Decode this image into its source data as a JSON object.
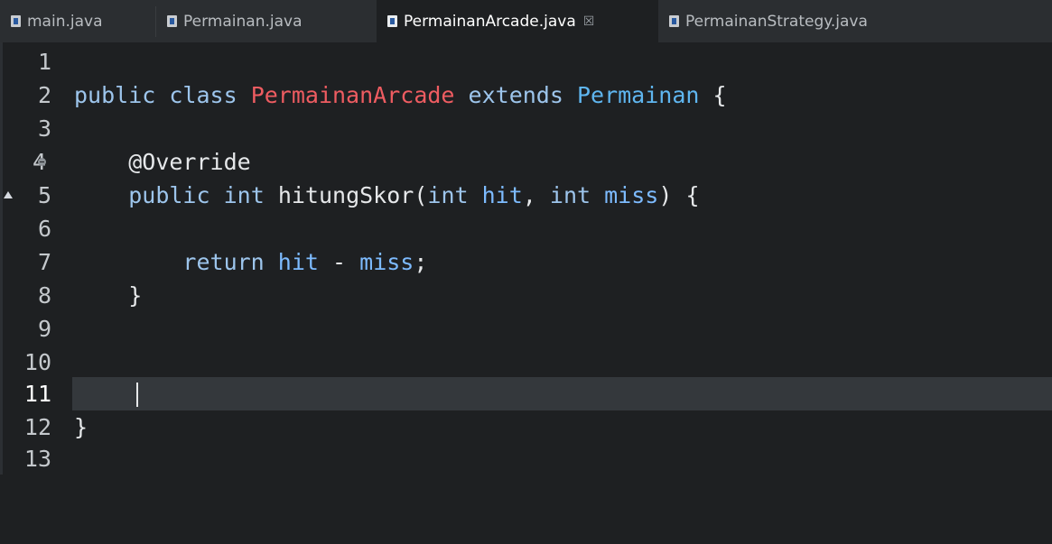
{
  "tabs": [
    {
      "label": "main.java",
      "active": false,
      "icon": "java-file-icon"
    },
    {
      "label": "Permainan.java",
      "active": false,
      "icon": "java-file-icon"
    },
    {
      "label": "PermainanArcade.java",
      "active": true,
      "icon": "java-file-icon",
      "close": "☒"
    },
    {
      "label": "PermainanStrategy.java",
      "active": false,
      "icon": "java-file-icon"
    }
  ],
  "editor": {
    "current_line": 11,
    "lines": [
      {
        "number": "1"
      },
      {
        "number": "2",
        "tokens": [
          "public",
          "class",
          "PermainanArcade",
          "extends",
          "Permainan",
          "{"
        ]
      },
      {
        "number": "3"
      },
      {
        "number": "4",
        "tokens": [
          "@Override"
        ]
      },
      {
        "number": "5",
        "tokens": [
          "public",
          "int",
          "hitungSkor(",
          "int",
          "hit",
          ",",
          "int",
          "miss",
          ")",
          "{"
        ]
      },
      {
        "number": "6"
      },
      {
        "number": "7",
        "tokens": [
          "return",
          "hit",
          "-",
          "miss",
          ";"
        ]
      },
      {
        "number": "8",
        "tokens": [
          "}"
        ]
      },
      {
        "number": "9"
      },
      {
        "number": "10"
      },
      {
        "number": "11"
      },
      {
        "number": "12",
        "tokens": [
          "}"
        ]
      },
      {
        "number": "13"
      }
    ]
  },
  "colors": {
    "keyword": "#9dc5ec",
    "class_name": "#ee5c61",
    "type_name": "#5fb6f0",
    "parameter": "#7dbbff",
    "background": "#1e2022",
    "current_line": "#34383c"
  }
}
